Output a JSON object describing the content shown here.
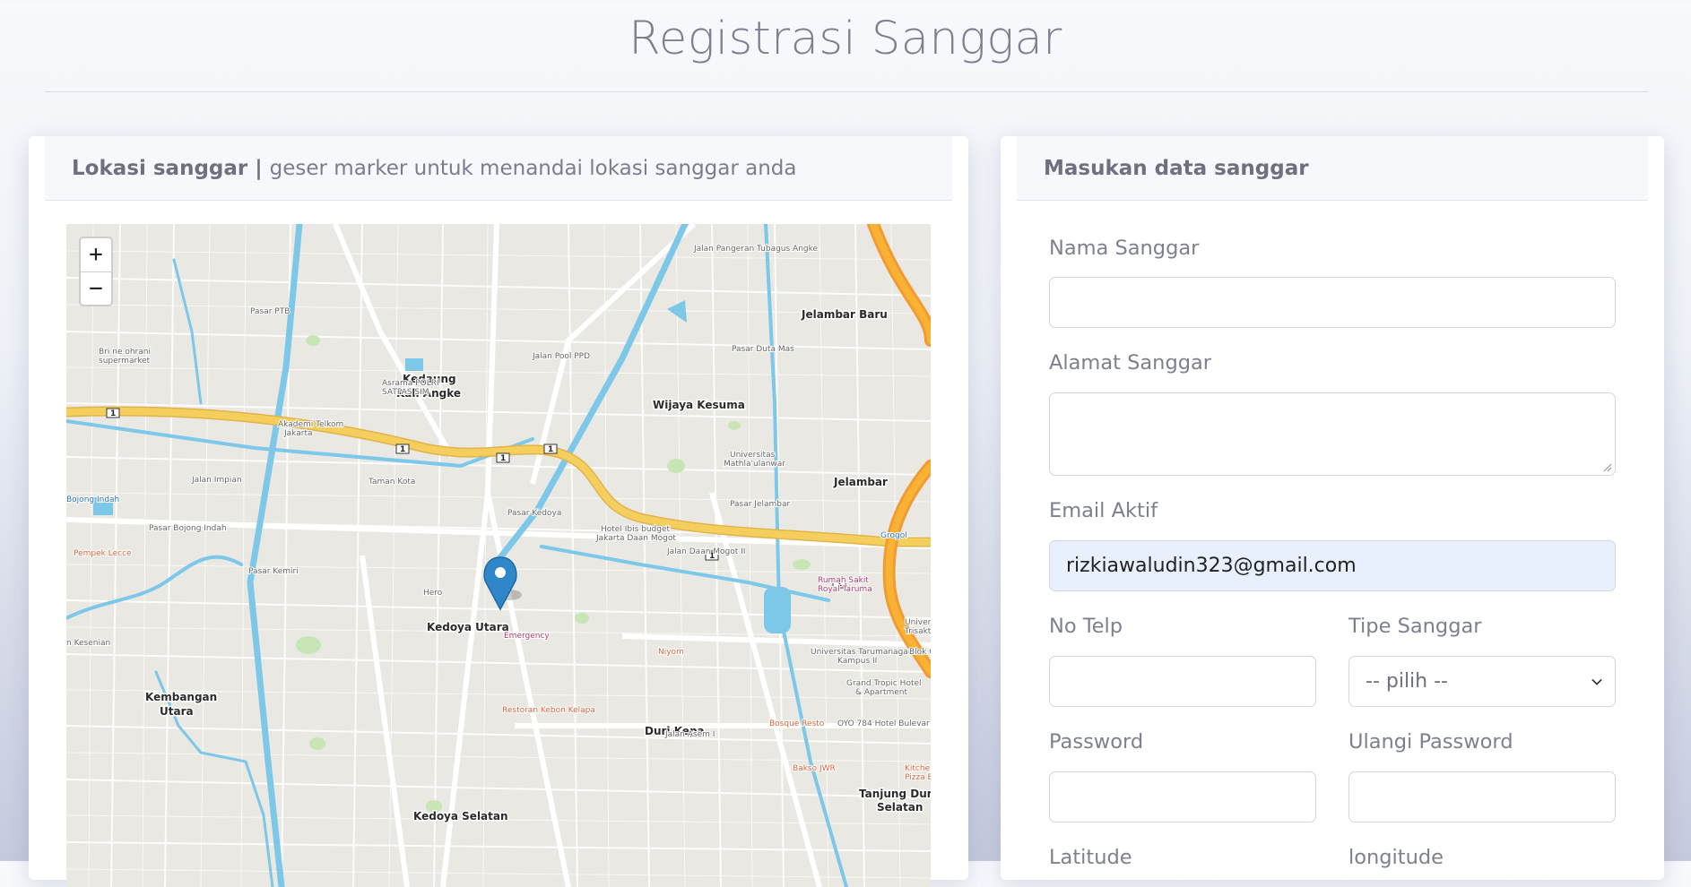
{
  "page": {
    "title": "Registrasi Sanggar"
  },
  "map_card": {
    "header_bold": "Lokasi sanggar",
    "header_separator": " | ",
    "header_text": "geser marker untuk menandai lokasi sanggar anda",
    "zoom_in": "+",
    "zoom_out": "−",
    "labels": {
      "jelambar_baru": "Jelambar Baru",
      "kedaung": "Kedaung",
      "kali_angke": "Kali Angke",
      "wijaya_kesuma": "Wijaya Kesuma",
      "jelambar": "Jelambar",
      "kedoya_utara": "Kedoya Utara",
      "kembangan": "Kembangan",
      "utara": "Utara",
      "duri_kepa": "Duri Kepa",
      "tanjung_duren": "Tanjung Duren",
      "selatan": "Selatan",
      "kedoya_selatan": "Kedoya Selatan",
      "pasar_ptb": "Pasar PTB",
      "pasar_duta_mas": "Pasar Duta Mas",
      "taman_kota": "Taman Kota",
      "bojong_indah": "Bojong Indah",
      "pasar_bojong_indah": "Pasar Bojong Indah",
      "pempek_lecce": "Pempek Lecce",
      "pasar_kemiri": "Pasar Kemiri",
      "hero": "Hero",
      "emergency": "Emergency",
      "niyom": "Niyom",
      "restoran_kebon_kelapa": "Restoran Kebon Kelapa",
      "bosque_resto": "Bosque Resto",
      "bakso_jwr": "Bakso JWR",
      "grogol": "Grogol",
      "rumah_sakit": "Rumah Sakit",
      "royal_taruma": "Royal Taruma",
      "univ_taruma": "Universitas Tarumanagara",
      "kampus_ii": "Kampus II",
      "hotel_ibis": "Hotel Ibis budget",
      "jakarta_daan_mogot": "Jakarta Daan Mogot",
      "univ_mathla": "Universitas",
      "mathla": "Mathla'ulanwar",
      "pasar_jelambar": "Pasar Jelambar",
      "grand_tropic": "Grand Tropic Hotel",
      "apartment": "& Apartment",
      "oyo": "OYO 784 Hotel Bulevar",
      "asrama": "Asrama POLRI",
      "satpas": "SATPAS SIM",
      "akademi": "Akademi Telkom",
      "jakarta": "Jakarta",
      "bri": "Bri ne ohrani",
      "supermarket": "supermarket",
      "jalan_daan_mogot": "Jalan Daan Mogot II",
      "jalan_impian": "Jalan Impian",
      "jalan_pos_ppd": "Jalan Pool PPD",
      "jalan_tubagus": "Jalan Pangeran Tubagus Angke",
      "jalan_asem": "Jalan Asem I",
      "pasar_kedoya": "Pasar Kedoya",
      "kitchen": "Kitchen",
      "pizza": "Pizza E",
      "univ_trisakti": "Universi",
      "trisakti": "Trisakti Kam",
      "blok": "Blok C",
      "kesenian": "n Kesenian",
      "route1": "1"
    }
  },
  "form_card": {
    "header": "Masukan data sanggar",
    "nama_label": "Nama Sanggar",
    "nama_value": "",
    "alamat_label": "Alamat Sanggar",
    "alamat_value": "",
    "email_label": "Email Aktif",
    "email_value": "rizkiawaludin323@gmail.com",
    "telp_label": "No Telp",
    "telp_value": "",
    "tipe_label": "Tipe Sanggar",
    "tipe_selected": "-- pilih --",
    "password_label": "Password",
    "password_value": "",
    "ulangi_label": "Ulangi Password",
    "ulangi_value": "",
    "latitude_label": "Latitude",
    "longitude_label": "longitude"
  },
  "colors": {
    "toll_road": "#f9b233",
    "main_road": "#f4cf5e",
    "water": "#7dc7e8",
    "marker": "#2f86c8"
  },
  "icons": [
    "map-marker-icon",
    "chevron-down-icon",
    "resize-handle-icon"
  ]
}
